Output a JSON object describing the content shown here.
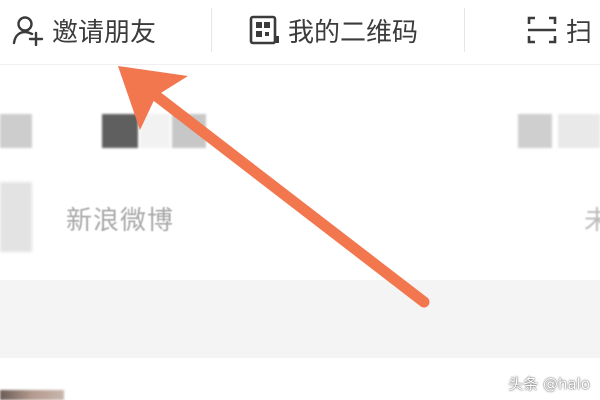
{
  "action_bar": {
    "invite_label": "邀请朋友",
    "invite_icon": "add-person-icon",
    "qrcode_label": "我的二维码",
    "qrcode_icon": "qr-code-icon",
    "scan_label": "扫",
    "scan_icon": "scan-icon"
  },
  "list": {
    "weibo_label": "新浪微博",
    "weibo_right_text": "未"
  },
  "annotation": {
    "arrow_color": "#f2774f",
    "arrow_target": "invite-friends-button"
  },
  "watermark": {
    "text": "头条 @halo"
  }
}
